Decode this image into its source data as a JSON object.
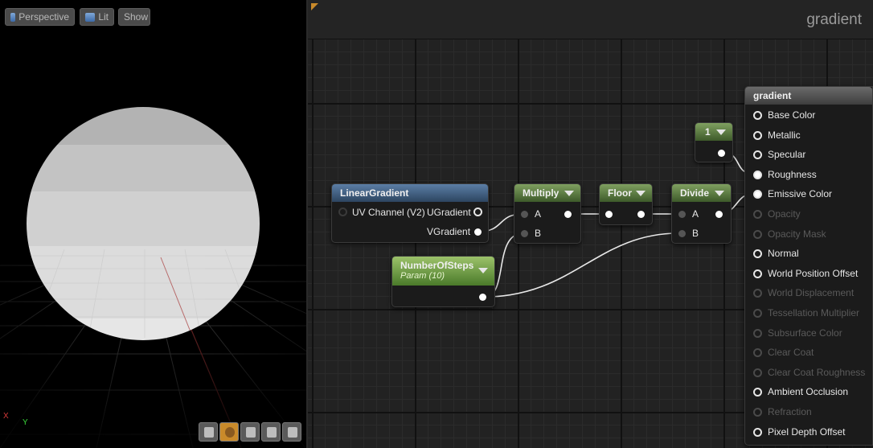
{
  "viewport": {
    "buttons": {
      "perspective": "Perspective",
      "lit": "Lit",
      "show": "Show"
    },
    "axes": {
      "x": "X",
      "y": "Y"
    }
  },
  "graph": {
    "title": "gradient",
    "nodes": {
      "linear_gradient": {
        "title": "LinearGradient",
        "input": "UV Channel (V2)",
        "out_u": "UGradient",
        "out_v": "VGradient"
      },
      "multiply": {
        "title": "Multiply",
        "a": "A",
        "b": "B"
      },
      "floor": {
        "title": "Floor"
      },
      "divide": {
        "title": "Divide",
        "a": "A",
        "b": "B"
      },
      "constant": {
        "title": "1"
      },
      "steps": {
        "title": "NumberOfSteps",
        "subtitle": "Param (10)"
      }
    },
    "material": {
      "title": "gradient",
      "inputs": [
        {
          "label": "Base Color",
          "enabled": true,
          "connected": false
        },
        {
          "label": "Metallic",
          "enabled": true,
          "connected": false
        },
        {
          "label": "Specular",
          "enabled": true,
          "connected": false
        },
        {
          "label": "Roughness",
          "enabled": true,
          "connected": true
        },
        {
          "label": "Emissive Color",
          "enabled": true,
          "connected": true
        },
        {
          "label": "Opacity",
          "enabled": false,
          "connected": false
        },
        {
          "label": "Opacity Mask",
          "enabled": false,
          "connected": false
        },
        {
          "label": "Normal",
          "enabled": true,
          "connected": false
        },
        {
          "label": "World Position Offset",
          "enabled": true,
          "connected": false
        },
        {
          "label": "World Displacement",
          "enabled": false,
          "connected": false
        },
        {
          "label": "Tessellation Multiplier",
          "enabled": false,
          "connected": false
        },
        {
          "label": "Subsurface Color",
          "enabled": false,
          "connected": false
        },
        {
          "label": "Clear Coat",
          "enabled": false,
          "connected": false
        },
        {
          "label": "Clear Coat Roughness",
          "enabled": false,
          "connected": false
        },
        {
          "label": "Ambient Occlusion",
          "enabled": true,
          "connected": false
        },
        {
          "label": "Refraction",
          "enabled": false,
          "connected": false
        },
        {
          "label": "Pixel Depth Offset",
          "enabled": true,
          "connected": false
        }
      ]
    }
  }
}
